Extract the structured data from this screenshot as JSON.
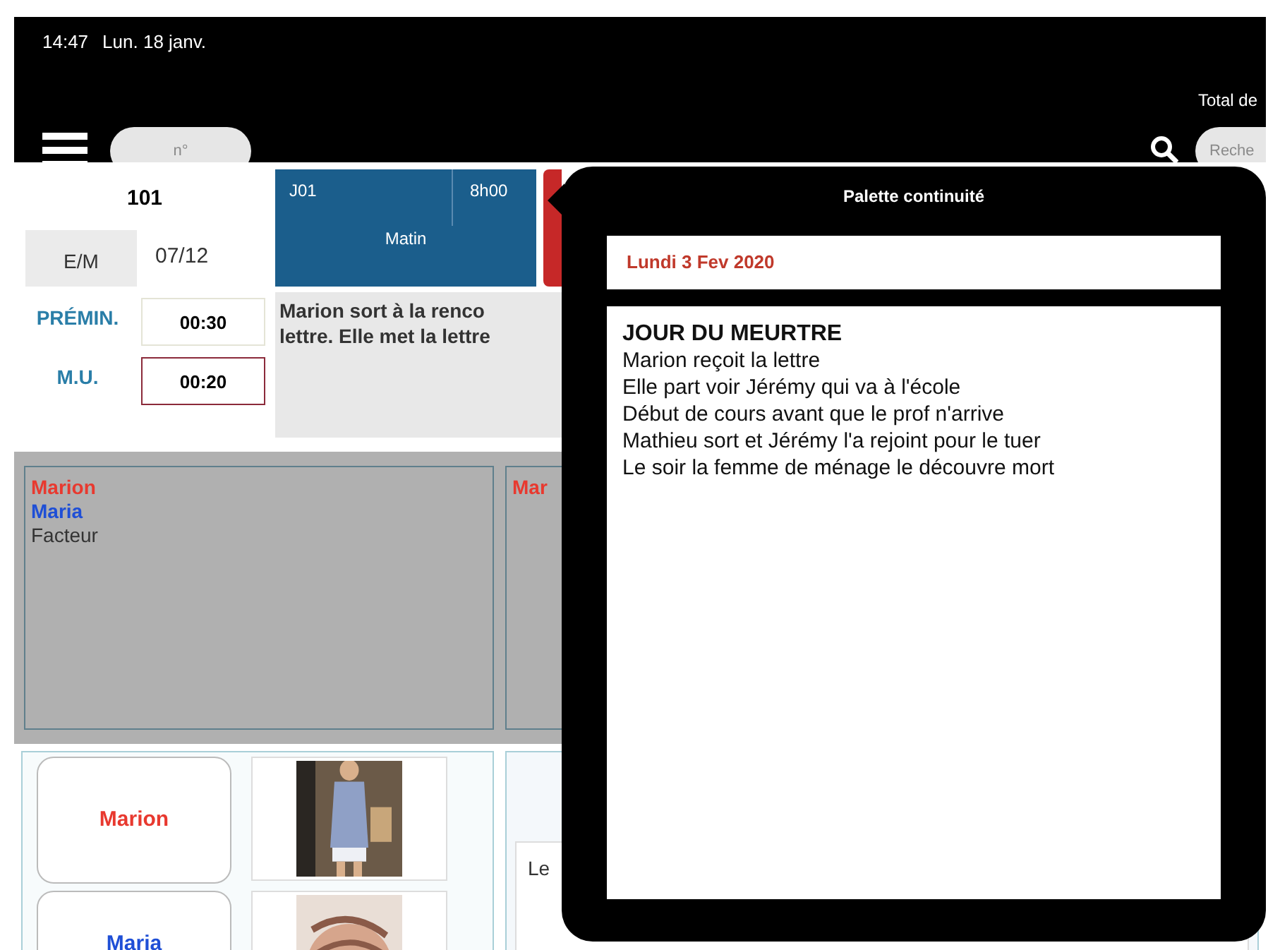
{
  "status_bar": {
    "time": "14:47",
    "date": "Lun. 18 janv."
  },
  "toolbar": {
    "number_field": {
      "placeholder": "n°"
    },
    "total_label": "Total de",
    "search_field": {
      "placeholder": "Reche"
    }
  },
  "scene": {
    "number": "101",
    "type_button": "E/M",
    "date": "07/12"
  },
  "timings": [
    {
      "label": "PRÉMIN.",
      "value": "00:30",
      "selected": false
    },
    {
      "label": "M.U.",
      "value": "00:20",
      "selected": true
    }
  ],
  "cards": [
    {
      "day": "J01",
      "time": "8h00",
      "period": "Matin",
      "color": "#1b5e8c"
    },
    {
      "color": "#c62828"
    }
  ],
  "summary_lines": [
    "Marion sort à la renco",
    "lettre. Elle met la lettre"
  ],
  "cast_panels": [
    {
      "characters": [
        {
          "name": "Marion",
          "color": "#e8392f"
        },
        {
          "name": "Maria",
          "color": "#1f4fd6"
        },
        {
          "name": "Facteur",
          "color": "#333333"
        }
      ]
    },
    {
      "characters": [
        {
          "name": "Mar",
          "color": "#e8392f"
        }
      ]
    }
  ],
  "costumes": [
    {
      "character": "Marion",
      "color": "#e8392f"
    },
    {
      "character": "Maria",
      "color": "#1f4fd6"
    }
  ],
  "notes_field": {
    "value": "Le"
  },
  "palette": {
    "title": "Palette continuité",
    "date": "Lundi 3 Fev 2020",
    "heading": "JOUR DU MEURTRE",
    "lines": [
      "Marion reçoit la lettre",
      "Elle part voir Jérémy qui va à l'école",
      "Début de cours avant que le prof n'arrive",
      "Mathieu sort et Jérémy l'a rejoint pour le tuer",
      "Le soir la femme de ménage le découvre mort"
    ]
  }
}
